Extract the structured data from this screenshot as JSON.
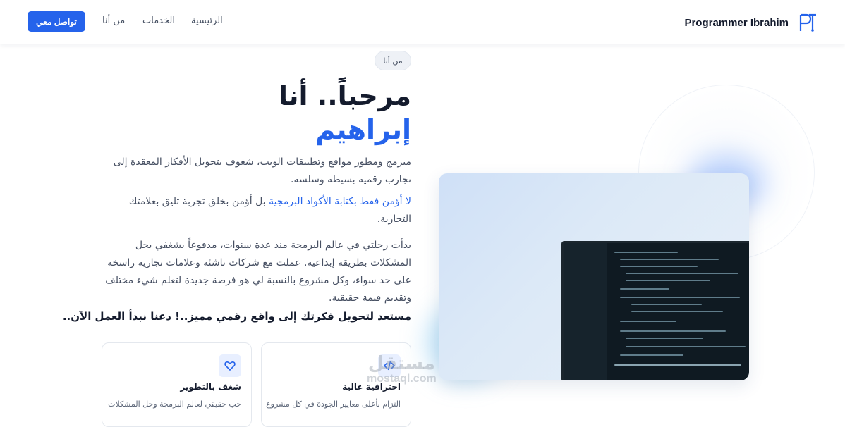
{
  "nav": {
    "brand": "Programmer Ibrahim",
    "links": [
      "الرئيسية",
      "الخدمات",
      "من أنا"
    ],
    "cta": "تواصل معي"
  },
  "hero": {
    "badge": "من أنا",
    "title": "مرحباً.. أنا",
    "name": "إبراهيم",
    "p1": "مبرمج ومطور مواقع وتطبيقات الويب، شغوف بتحويل الأفكار المعقدة إلى تجارب رقمية بسيطة وسلسة.",
    "p2_highlight": "لا أؤمن فقط بكتابة الأكواد البرمجية",
    "p2_rest": "بل أؤمن بخلق تجربة تليق بعلامتك التجارية.",
    "p3": "بدأت رحلتي في عالم البرمجة منذ عدة سنوات، مدفوعاً بشغفي بحل المشكلات بطريقة إبداعية. عملت مع شركات ناشئة وعلامات تجارية راسخة على حد سواء، وكل مشروع بالنسبة لي هو فرصة جديدة لتعلم شيء مختلف وتقديم قيمة حقيقية.",
    "cta_text": "مستعد لتحويل فكرتك إلى واقع رقمي مميز..! دعنا نبدأ العمل الآن.."
  },
  "cards": [
    {
      "icon": "code-icon",
      "title": "احترافية عالية",
      "desc": "التزام بأعلى معايير الجودة في كل مشروع"
    },
    {
      "icon": "heart-icon",
      "title": "شغف بالتطوير",
      "desc": "حب حقيقي لعالم البرمجة وحل المشكلات"
    }
  ],
  "watermark": {
    "ar": "مستقل",
    "en": "mostaql.com"
  },
  "colors": {
    "accent": "#2563eb",
    "heading": "#141b2d",
    "text": "#475063"
  }
}
